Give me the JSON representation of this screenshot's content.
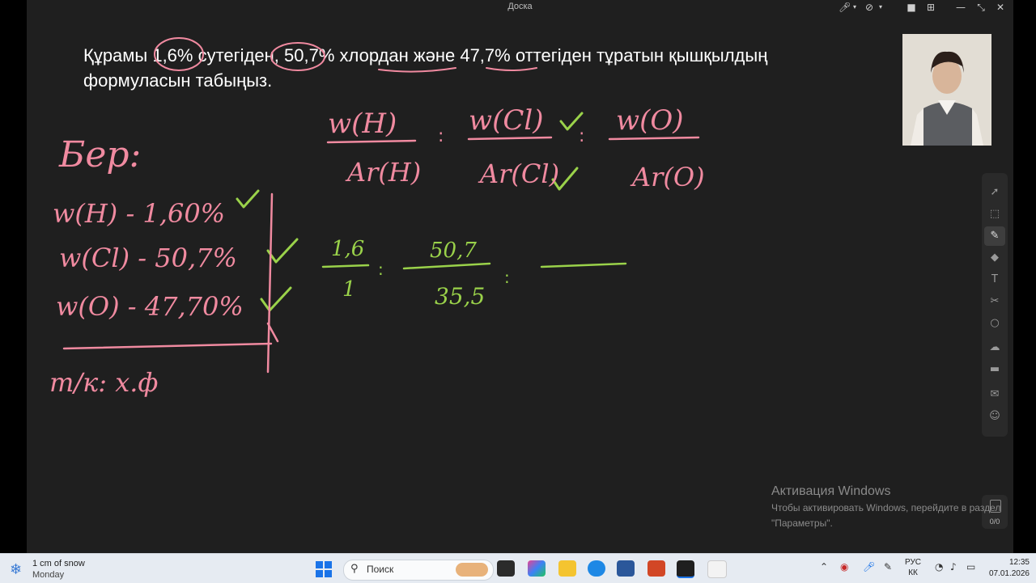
{
  "window": {
    "title": "Доска"
  },
  "task": {
    "line1": "Құрамы 1,6% сутегіден, 50,7% хлордан және 47,7% оттегіден тұратын қышқылдың",
    "line2": "формуласын табыңыз."
  },
  "board": {
    "given_title": "Бер:",
    "given_lines": [
      "w(H) - 1,60%",
      "w(Cl) - 50,7%",
      "w(O) - 47,70%"
    ],
    "find": "т/к: х.ф",
    "fractions_top": [
      "w(H)",
      "w(Cl)",
      "w(O)"
    ],
    "fractions_bottom": [
      "Ar(H)",
      "Ar(Cl)",
      "Ar(O)"
    ],
    "calc_top": [
      "1,6",
      "50,7"
    ],
    "calc_bottom": [
      "1",
      "35,5"
    ],
    "ink_colors": {
      "pink": "#f08aa0",
      "green": "#9ad24a"
    }
  },
  "toolbar": {
    "tools": [
      "cursor-icon",
      "select-icon",
      "pen-icon",
      "eraser-icon",
      "text-icon",
      "scissors-icon",
      "shape-icon",
      "cloud-icon",
      "toolbox-icon",
      "chat-icon",
      "people-icon"
    ]
  },
  "page_counter": {
    "value": "0/0"
  },
  "activation": {
    "heading": "Активация Windows",
    "line1": "Чтобы активировать Windows, перейдите в раздел",
    "line2": "\"Параметры\"."
  },
  "taskbar": {
    "weather_line1": "1 cm of snow",
    "weather_line2": "Monday",
    "search_placeholder": "Поиск",
    "lang_line1": "РУС",
    "lang_line2": "КК",
    "time": "12:35",
    "date": "07.01.2026"
  }
}
